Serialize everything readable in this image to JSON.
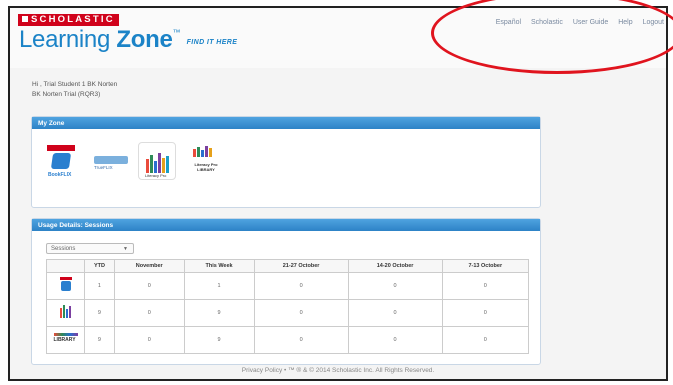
{
  "header": {
    "brand": "SCHOLASTIC",
    "logo_text": "Learning",
    "logo_text_bold": "Zone",
    "logo_tm": "™",
    "tagline": "FIND IT HERE",
    "nav": [
      "Español",
      "Scholastic",
      "User Guide",
      "Help",
      "Logout"
    ]
  },
  "greeting": {
    "line1": "Hi , Trial Student 1 BK Norten",
    "line2": "BK Norten Trial (RQR3)"
  },
  "my_zone": {
    "title": "My Zone",
    "tiles": [
      {
        "name": "bookflix",
        "caption": "BookFLIX"
      },
      {
        "name": "truflix",
        "caption": "TrueFLIX"
      },
      {
        "name": "literacy-pro",
        "caption": "Literacy Pro"
      },
      {
        "name": "literacy-pro-library",
        "caption": "Literacy Pro LIBRARY"
      }
    ]
  },
  "usage": {
    "title": "Usage Details: Sessions",
    "select_value": "Sessions",
    "columns": [
      "",
      "YTD",
      "November",
      "This Week",
      "21-27 October",
      "14-20 October",
      "7-13 October"
    ],
    "rows": [
      {
        "product": "BookFLIX",
        "values": [
          "1",
          "0",
          "1",
          "0",
          "0",
          "0"
        ]
      },
      {
        "product": "Literacy Pro",
        "values": [
          "9",
          "0",
          "9",
          "0",
          "0",
          "0"
        ]
      },
      {
        "product": "Literacy Pro LIBRARY",
        "values": [
          "9",
          "0",
          "9",
          "0",
          "0",
          "0"
        ]
      }
    ]
  },
  "footer": {
    "text": "Privacy Policy  •  ™ ® & © 2014 Scholastic Inc. All Rights Reserved."
  },
  "colors": {
    "brand_red": "#d0021b",
    "logo_blue": "#1b83c7",
    "panel_header": "#2d82c6",
    "annotation_red": "#e0141e"
  }
}
